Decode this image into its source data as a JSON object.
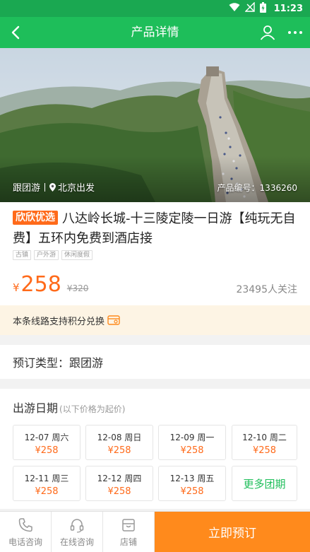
{
  "status_bar": {
    "time": "11:23",
    "icons": [
      "wifi-icon",
      "no-signal-icon",
      "battery-icon"
    ]
  },
  "header": {
    "title": "产品详情",
    "icons": [
      "back-icon",
      "user-icon",
      "more-icon"
    ]
  },
  "hero": {
    "tour_type": "跟团游",
    "departure": "北京出发",
    "product_code_label": "产品编号：",
    "product_code": "1336260"
  },
  "product": {
    "badge": "欣欣优选",
    "title": "八达岭长城-十三陵定陵一日游【纯玩无自费】五环内免费到酒店接",
    "tags": [
      "古镇",
      "户外游",
      "休闲度假"
    ],
    "currency": "¥",
    "price": "258",
    "original_price": "¥320",
    "followers": "23495人关注"
  },
  "points": {
    "text": "本条线路支持积分兑换"
  },
  "booking_type": {
    "label": "预订类型：",
    "value": "跟团游"
  },
  "dates": {
    "title": "出游日期",
    "note": "(以下价格为起价)",
    "items": [
      {
        "date": "12-07 周六",
        "price": "¥258"
      },
      {
        "date": "12-08 周日",
        "price": "¥258"
      },
      {
        "date": "12-09 周一",
        "price": "¥258"
      },
      {
        "date": "12-10 周二",
        "price": "¥258"
      },
      {
        "date": "12-11 周三",
        "price": "¥258"
      },
      {
        "date": "12-12 周四",
        "price": "¥258"
      },
      {
        "date": "12-13 周五",
        "price": "¥258"
      }
    ],
    "more_label": "更多团期"
  },
  "bottom": {
    "phone_label": "电话咨询",
    "online_label": "在线咨询",
    "store_label": "店铺",
    "book_label": "立即预订"
  },
  "colors": {
    "primary_green": "#1ebe5a",
    "status_green": "#1aa851",
    "accent_orange": "#ff6a1a",
    "book_button": "#ff8a1c",
    "points_bg": "#fdf4e4"
  }
}
